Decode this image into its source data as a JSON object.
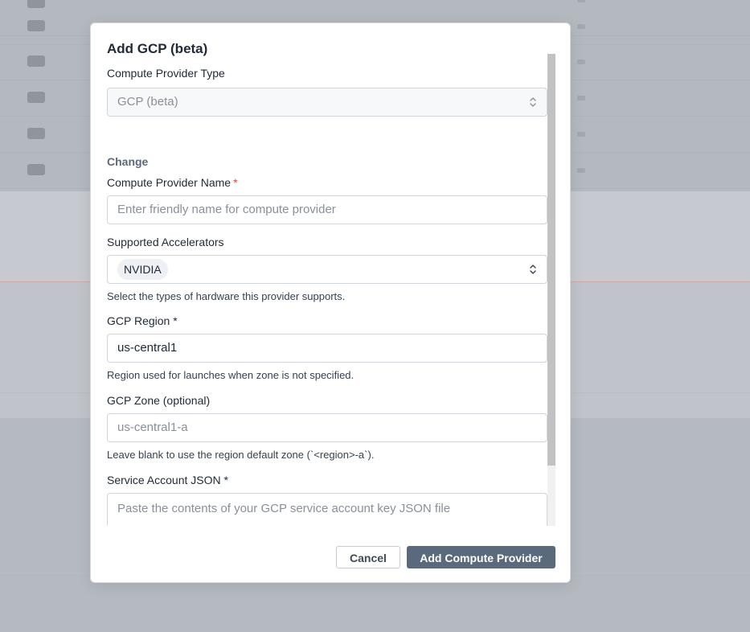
{
  "modal": {
    "title": "Add GCP (beta)",
    "compute_provider_type": {
      "label": "Compute Provider Type",
      "value": "GCP (beta)",
      "change_label": "Change"
    },
    "compute_provider_name": {
      "label": "Compute Provider Name",
      "required_mark": "*",
      "placeholder": "Enter friendly name for compute provider"
    },
    "supported_accelerators": {
      "label": "Supported Accelerators",
      "selected": [
        "NVIDIA"
      ],
      "help": "Select the types of hardware this provider supports."
    },
    "gcp_region": {
      "label": "GCP Region *",
      "value": "us-central1",
      "help": "Region used for launches when zone is not specified."
    },
    "gcp_zone": {
      "label": "GCP Zone (optional)",
      "placeholder": "us-central1-a",
      "help": "Leave blank to use the region default zone (`<region>-a`)."
    },
    "service_account_json": {
      "label": "Service Account JSON *",
      "placeholder": "Paste the contents of your GCP service account key JSON file"
    },
    "footer": {
      "cancel_label": "Cancel",
      "submit_label": "Add Compute Provider"
    }
  },
  "colors": {
    "primary_button": "#5a6a7c",
    "required_asterisk": "#e53e3e",
    "overlay": "#c2c6cc"
  }
}
